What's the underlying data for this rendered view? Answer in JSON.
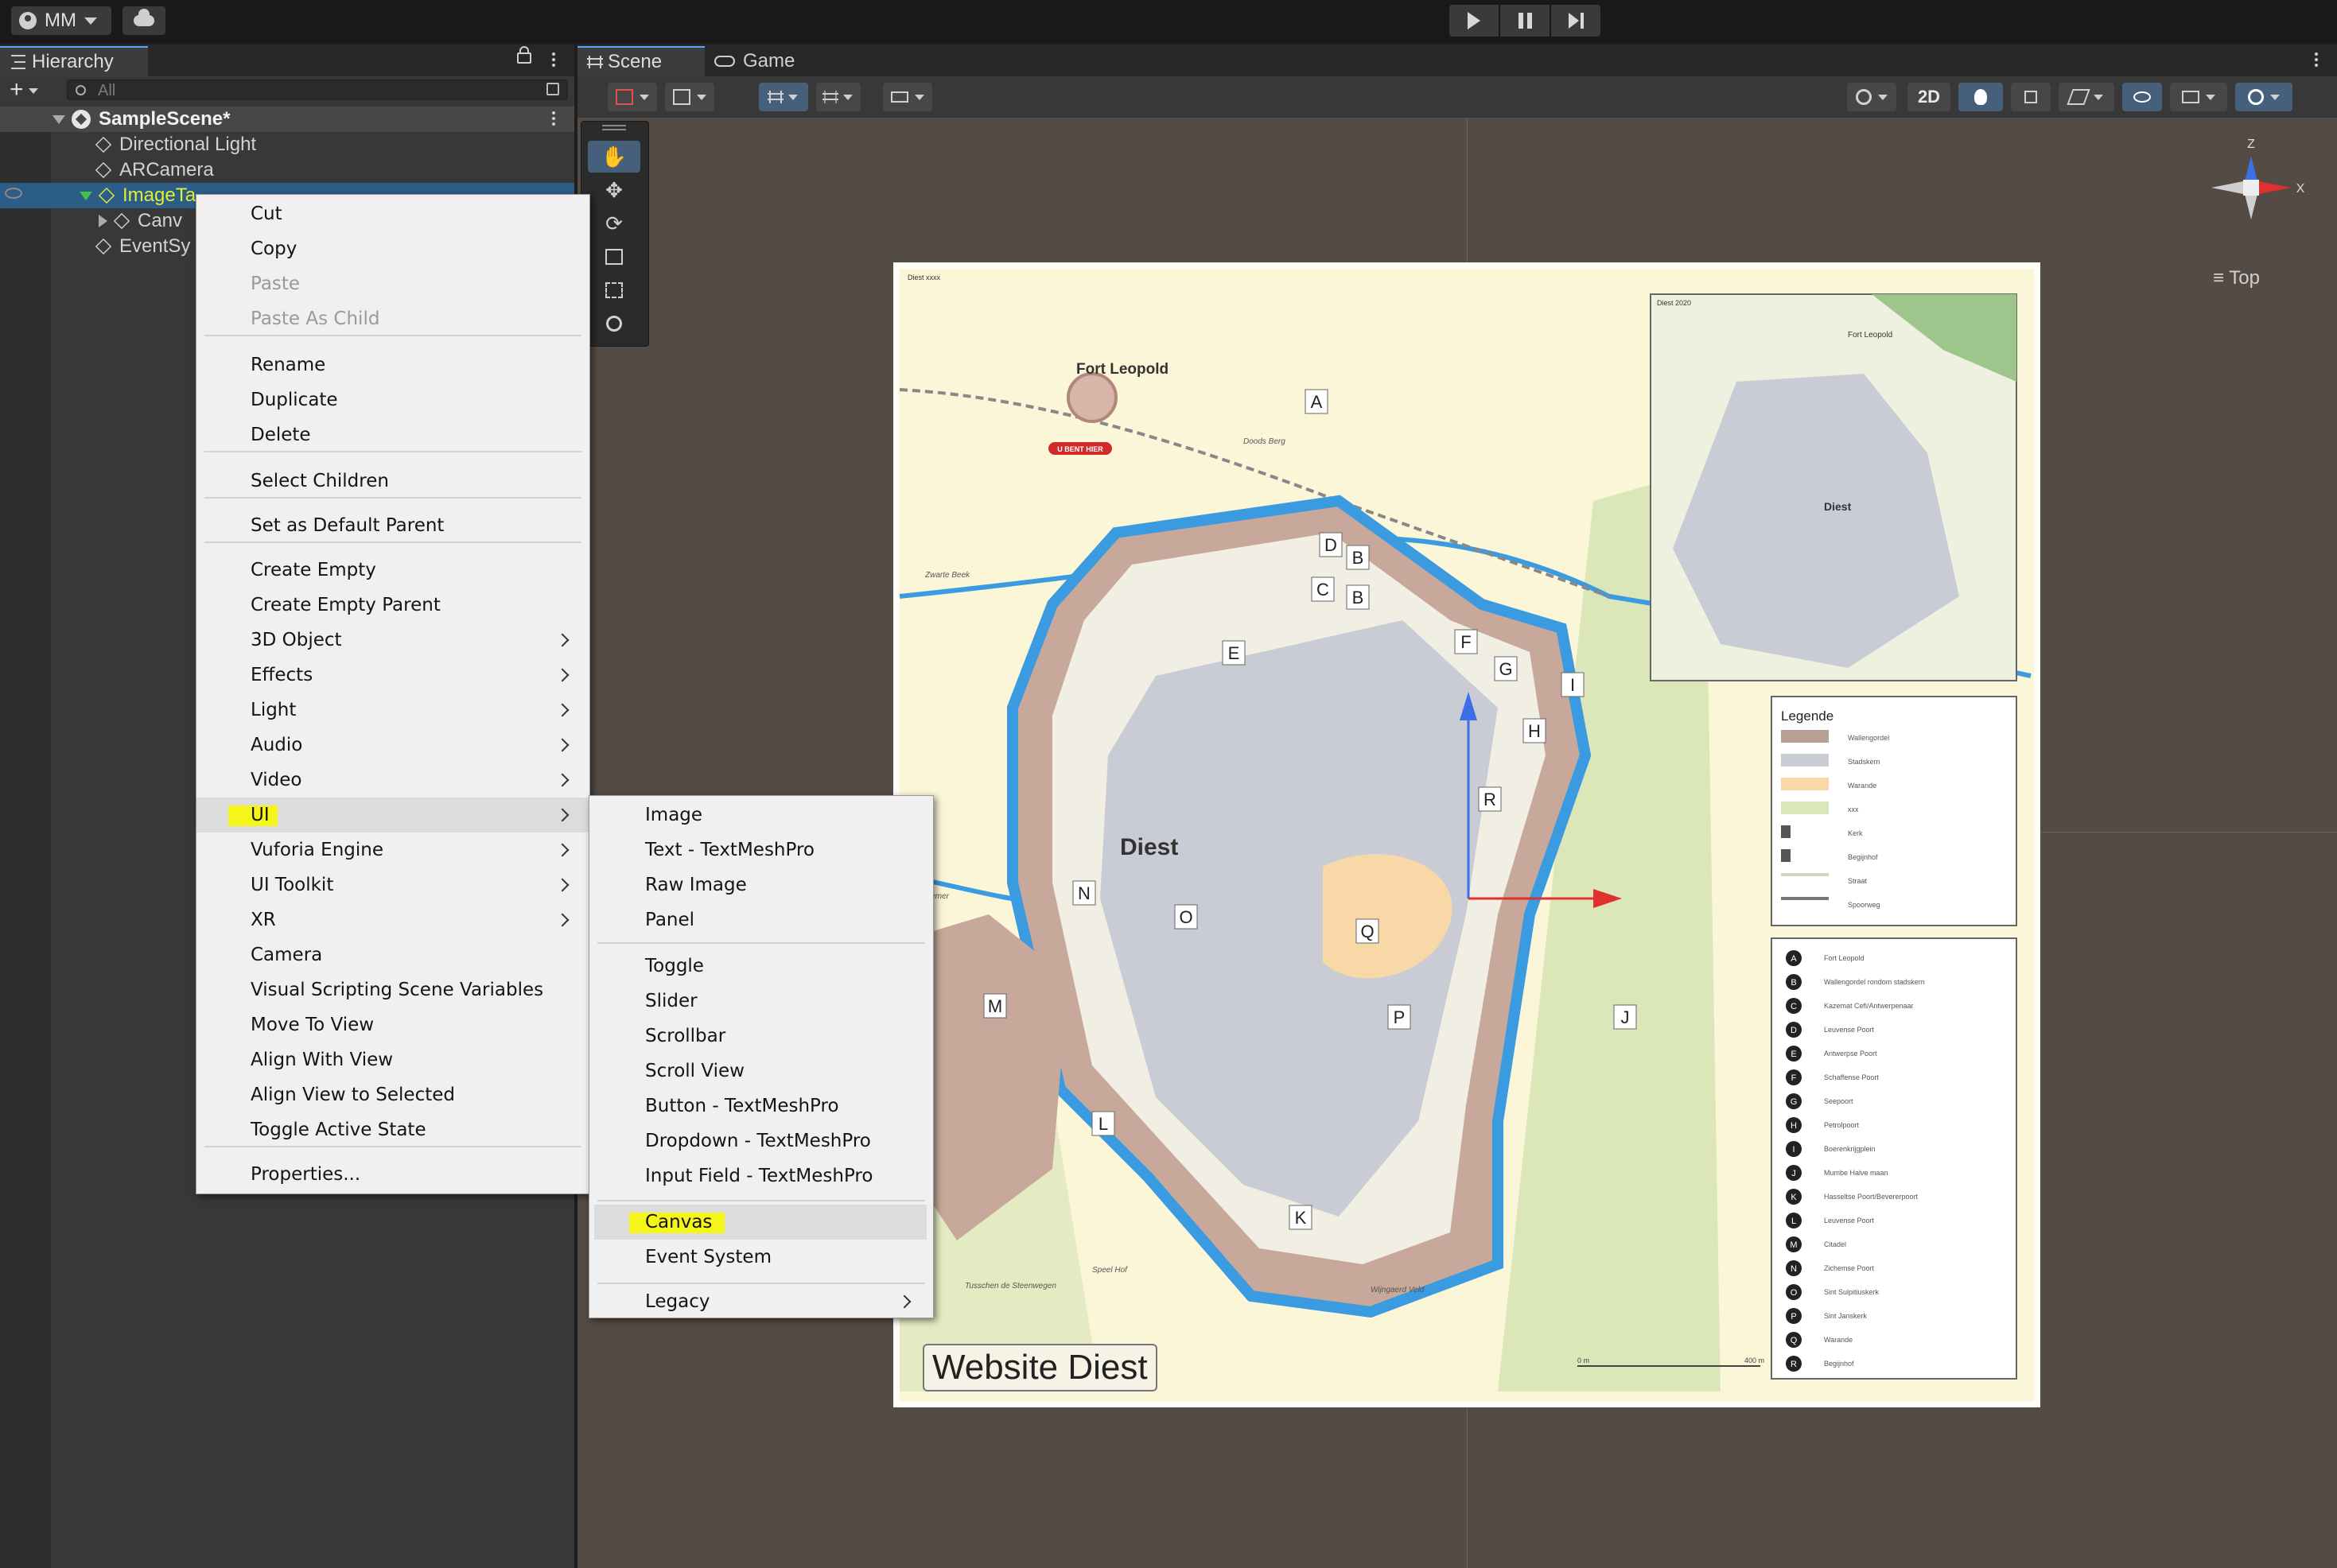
{
  "toolbar": {
    "account_label": "MM",
    "play_icon": "play-icon",
    "pause_icon": "pause-icon",
    "step_icon": "step-icon"
  },
  "hierarchy": {
    "tab_label": "Hierarchy",
    "search_placeholder": "All",
    "scene_name": "SampleScene*",
    "items": [
      {
        "label": "Directional Light"
      },
      {
        "label": "ARCamera"
      },
      {
        "label": "ImageTa"
      },
      {
        "label": "Canv"
      },
      {
        "label": "EventSy"
      }
    ]
  },
  "scene": {
    "scene_tab": "Scene",
    "game_tab": "Game",
    "btn_2d": "2D",
    "view_label": "Top",
    "gizmo_z": "Z",
    "gizmo_x": "X",
    "website_label": "Website Diest"
  },
  "map": {
    "header": "Diest xxxx",
    "inset_title": "Diest 2020",
    "inset_town": "Diest",
    "inset_fort": "Fort Leopold",
    "fort_label": "Fort Leopold",
    "you_are_here": "U BENT HIER",
    "town_label": "Diest",
    "place_doods_berg": "Doods Berg",
    "place_zwarte_beek": "Zwarte Beek",
    "place_demer": "Demer",
    "place_tusschen": "Tusschen de Steenwegen",
    "place_speelhof": "Speel Hof",
    "place_wijngaard": "Wijngaerd Veld",
    "scale_start": "0 m",
    "scale_end": "400 m",
    "legend_title": "Legende",
    "legend_items": [
      "Wallengordel",
      "Stadskern",
      "Warande",
      "xxx",
      "Kerk",
      "Begijnhof",
      "Straat",
      "Spoorweg"
    ],
    "index": [
      {
        "k": "A",
        "v": "Fort Leopold"
      },
      {
        "k": "B",
        "v": "Wallengordel rondom stadskern"
      },
      {
        "k": "C",
        "v": "Kazemat Cefi/Antwerpenaar"
      },
      {
        "k": "D",
        "v": "Leuvense Poort"
      },
      {
        "k": "E",
        "v": "Antwerpse Poort"
      },
      {
        "k": "F",
        "v": "Schaffense Poort"
      },
      {
        "k": "G",
        "v": "Seepoort"
      },
      {
        "k": "H",
        "v": "Petrolpoort"
      },
      {
        "k": "I",
        "v": "Boerenkrijgplein"
      },
      {
        "k": "J",
        "v": "Mumbe Halve maan"
      },
      {
        "k": "K",
        "v": "Hasseltse Poort/Bevererpoort"
      },
      {
        "k": "L",
        "v": "Leuvense Poort"
      },
      {
        "k": "M",
        "v": "Citadel"
      },
      {
        "k": "N",
        "v": "Zichemse Poort"
      },
      {
        "k": "O",
        "v": "Sint Sulpitiuskerk"
      },
      {
        "k": "P",
        "v": "Sint Janskerk"
      },
      {
        "k": "Q",
        "v": "Warande"
      },
      {
        "k": "R",
        "v": "Begijnhof"
      }
    ],
    "markers": [
      "A",
      "B",
      "B",
      "C",
      "D",
      "E",
      "F",
      "G",
      "H",
      "I",
      "J",
      "K",
      "L",
      "M",
      "N",
      "O",
      "P",
      "Q",
      "R"
    ]
  },
  "context_menu": {
    "items": [
      {
        "label": "Cut",
        "enabled": true
      },
      {
        "label": "Copy",
        "enabled": true
      },
      {
        "label": "Paste",
        "enabled": false
      },
      {
        "label": "Paste As Child",
        "enabled": false
      },
      {
        "label": "Rename",
        "enabled": true
      },
      {
        "label": "Duplicate",
        "enabled": true
      },
      {
        "label": "Delete",
        "enabled": true
      },
      {
        "label": "Select Children",
        "enabled": true
      },
      {
        "label": "Set as Default Parent",
        "enabled": true
      },
      {
        "label": "Create Empty",
        "enabled": true
      },
      {
        "label": "Create Empty Parent",
        "enabled": true
      },
      {
        "label": "3D Object",
        "enabled": true
      },
      {
        "label": "Effects",
        "enabled": true
      },
      {
        "label": "Light",
        "enabled": true
      },
      {
        "label": "Audio",
        "enabled": true
      },
      {
        "label": "Video",
        "enabled": true
      },
      {
        "label": "UI",
        "enabled": true
      },
      {
        "label": "Vuforia Engine",
        "enabled": true
      },
      {
        "label": "UI Toolkit",
        "enabled": true
      },
      {
        "label": "XR",
        "enabled": true
      },
      {
        "label": "Camera",
        "enabled": true
      },
      {
        "label": "Visual Scripting Scene Variables",
        "enabled": true
      },
      {
        "label": "Move To View",
        "enabled": true
      },
      {
        "label": "Align With View",
        "enabled": true
      },
      {
        "label": "Align View to Selected",
        "enabled": true
      },
      {
        "label": "Toggle Active State",
        "enabled": true
      },
      {
        "label": "Properties...",
        "enabled": true
      }
    ]
  },
  "ui_submenu": {
    "items": [
      {
        "label": "Image"
      },
      {
        "label": "Text - TextMeshPro"
      },
      {
        "label": "Raw Image"
      },
      {
        "label": "Panel"
      },
      {
        "label": "Toggle"
      },
      {
        "label": "Slider"
      },
      {
        "label": "Scrollbar"
      },
      {
        "label": "Scroll View"
      },
      {
        "label": "Button - TextMeshPro"
      },
      {
        "label": "Dropdown - TextMeshPro"
      },
      {
        "label": "Input Field - TextMeshPro"
      },
      {
        "label": "Canvas"
      },
      {
        "label": "Event System"
      },
      {
        "label": "Legacy"
      }
    ]
  },
  "colors": {
    "selection": "#2c5d87",
    "highlight": "#f6f51a",
    "water": "#3b9be0",
    "walls": "#c8a89a",
    "town": "#c9ccd4"
  }
}
